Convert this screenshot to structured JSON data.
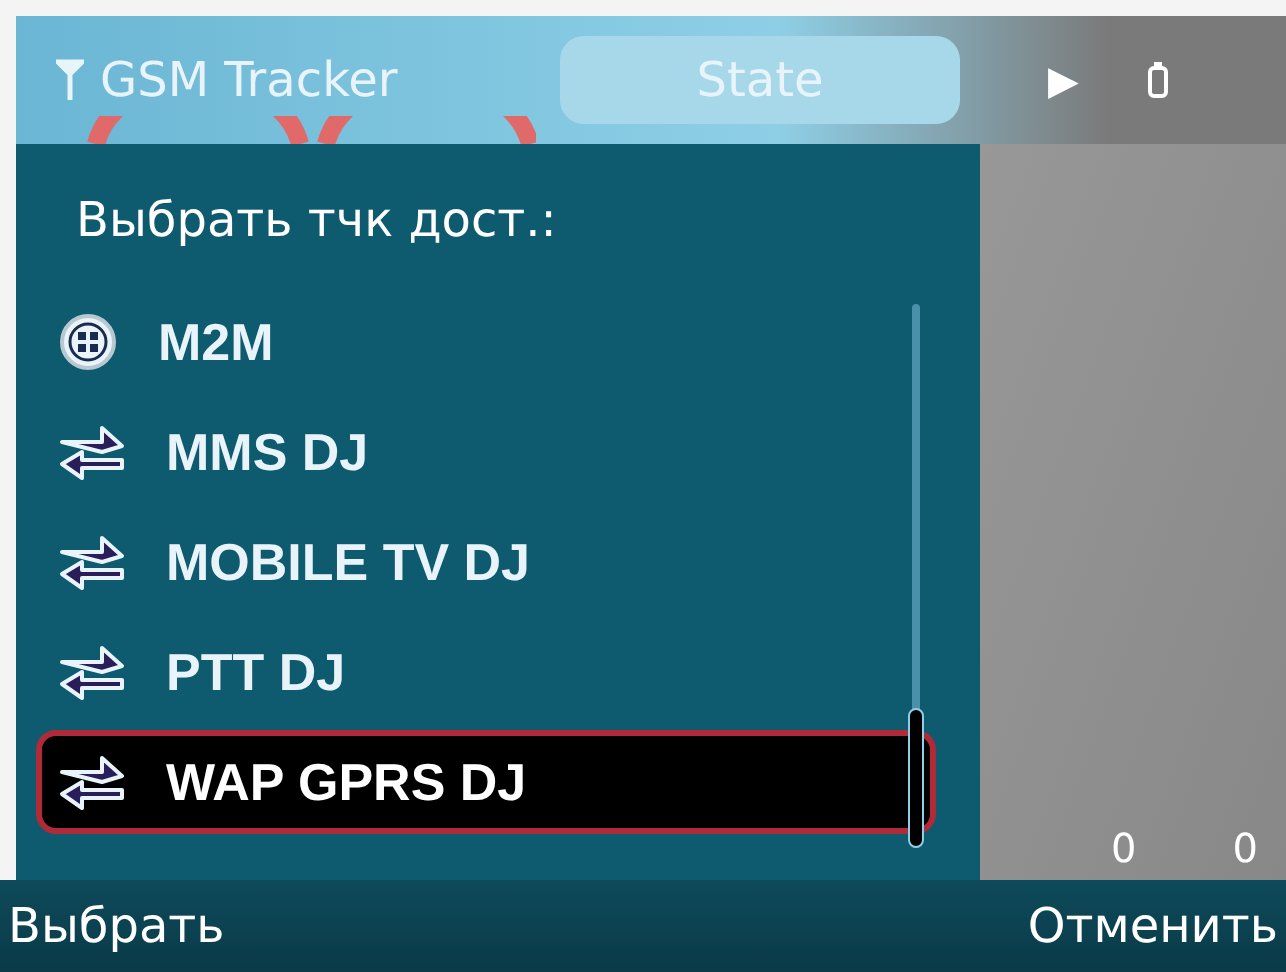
{
  "status_bar": {
    "title": "GSM Tracker",
    "tab": "State",
    "arrow": "▶"
  },
  "background": {
    "counters": [
      "0",
      "0"
    ]
  },
  "dialog": {
    "heading": "Выбрать тчк дост.:",
    "items": [
      {
        "label": "M2M",
        "kind": "group",
        "selected": false
      },
      {
        "label": "MMS DJ",
        "kind": "connection",
        "selected": false
      },
      {
        "label": "MOBILE TV DJ",
        "kind": "connection",
        "selected": false
      },
      {
        "label": "PTT DJ",
        "kind": "connection",
        "selected": false
      },
      {
        "label": "WAP GPRS DJ",
        "kind": "connection",
        "selected": true
      }
    ]
  },
  "softkeys": {
    "left": "Выбрать",
    "right": "Отменить"
  }
}
